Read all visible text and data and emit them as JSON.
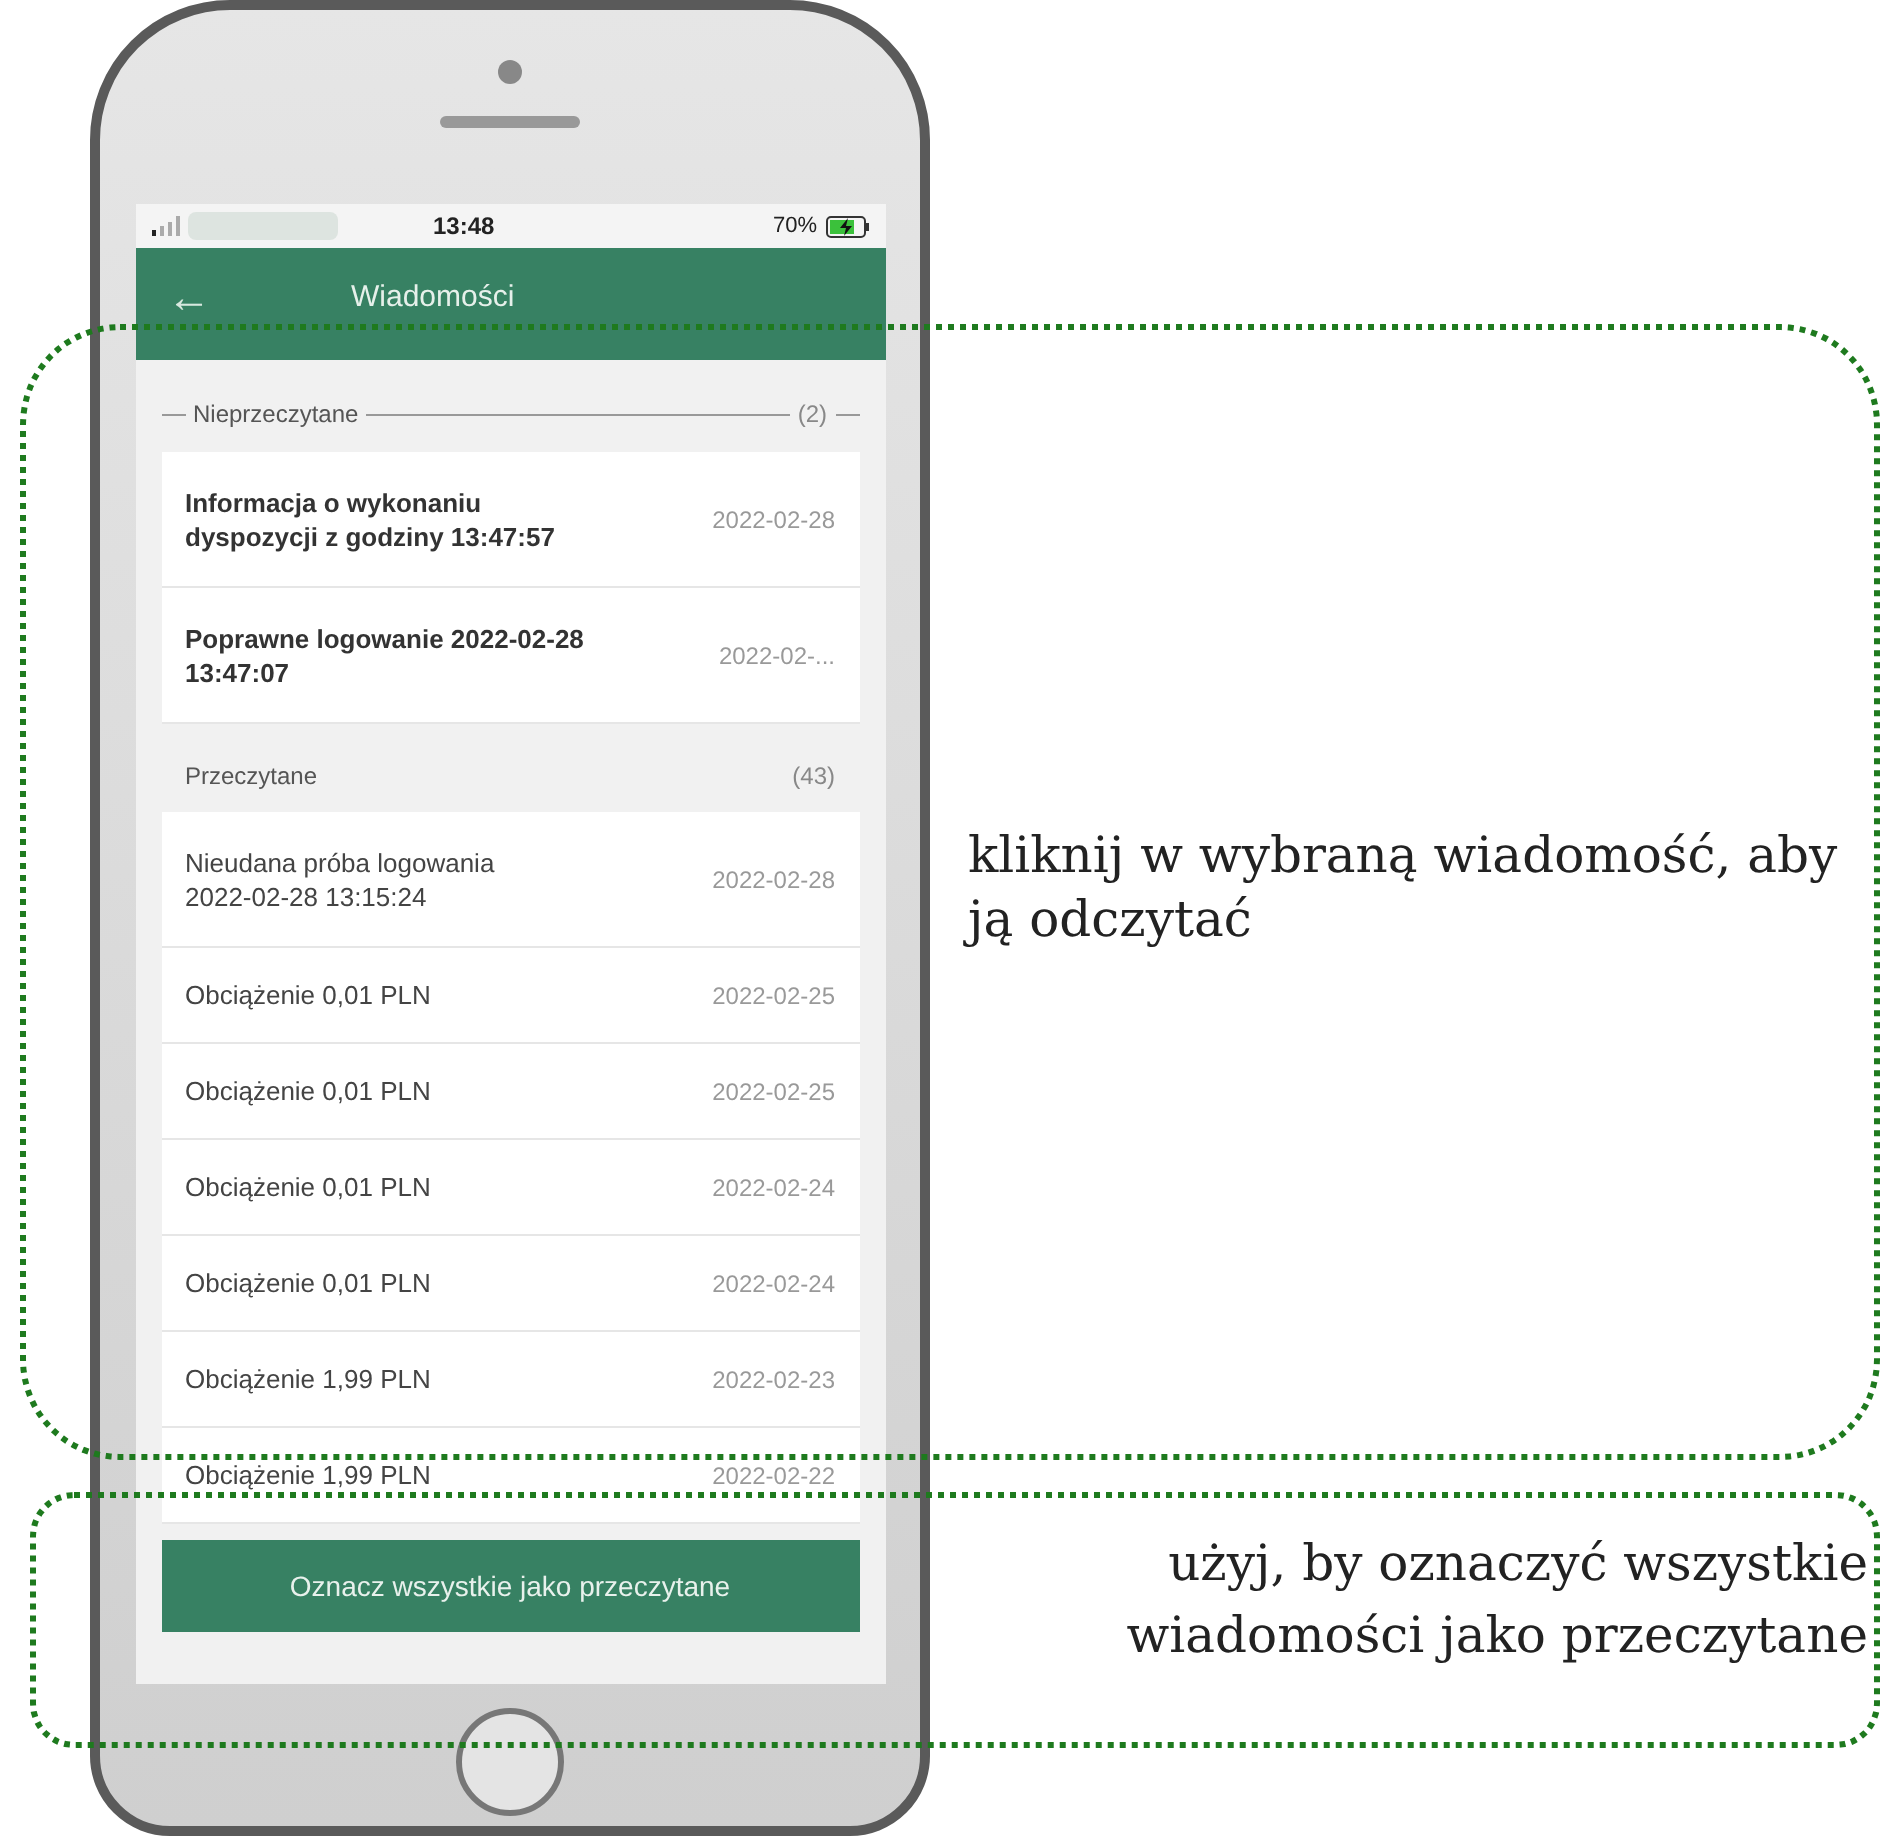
{
  "status_bar": {
    "time": "13:48",
    "battery": "70%"
  },
  "header": {
    "back": "←",
    "title": "Wiadomości"
  },
  "sections": [
    {
      "kind": "unread",
      "label": "Nieprzeczytane",
      "count": "(2)",
      "items": [
        {
          "text": "Informacja o wykonaniu dyspozycji z godziny 13:47:57",
          "date": "2022-02-28",
          "unread": true
        },
        {
          "text": "Poprawne logowanie 2022-02-28 13:47:07",
          "date": "2022-02-...",
          "unread": true
        }
      ]
    },
    {
      "kind": "read",
      "label": "Przeczytane",
      "count": "(43)",
      "items": [
        {
          "text": "Nieudana próba logowania 2022-02-28 13:15:24",
          "date": "2022-02-28",
          "unread": false
        },
        {
          "text": "Obciążenie 0,01 PLN",
          "date": "2022-02-25",
          "unread": false
        },
        {
          "text": "Obciążenie 0,01 PLN",
          "date": "2022-02-25",
          "unread": false
        },
        {
          "text": "Obciążenie 0,01 PLN",
          "date": "2022-02-24",
          "unread": false
        },
        {
          "text": "Obciążenie 0,01 PLN",
          "date": "2022-02-24",
          "unread": false
        },
        {
          "text": "Obciążenie 1,99 PLN",
          "date": "2022-02-23",
          "unread": false
        },
        {
          "text": "Obciążenie 1,99 PLN",
          "date": "2022-02-22",
          "unread": false
        }
      ]
    }
  ],
  "mark_all_button": "Oznacz wszystkie jako przeczytane",
  "annotations": [
    "kliknij w wybraną wiadomość, aby ją odczytać",
    "użyj, by oznaczyć wszystkie wiadomości jako przeczytane"
  ]
}
